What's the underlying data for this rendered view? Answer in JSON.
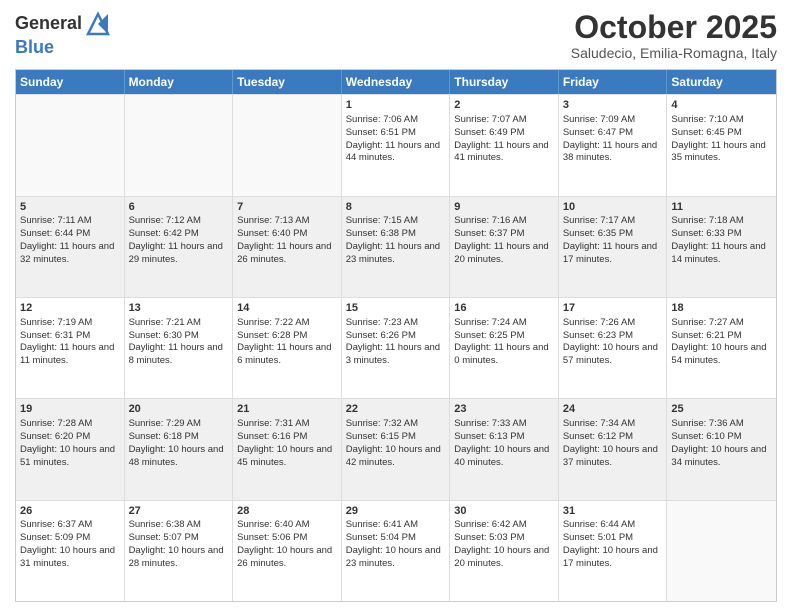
{
  "header": {
    "logo": {
      "line1": "General",
      "line2": "Blue"
    },
    "title": "October 2025",
    "location": "Saludecio, Emilia-Romagna, Italy"
  },
  "days_of_week": [
    "Sunday",
    "Monday",
    "Tuesday",
    "Wednesday",
    "Thursday",
    "Friday",
    "Saturday"
  ],
  "weeks": [
    [
      {
        "day": "",
        "empty": true
      },
      {
        "day": "",
        "empty": true
      },
      {
        "day": "",
        "empty": true
      },
      {
        "day": "1",
        "sunrise": "Sunrise: 7:06 AM",
        "sunset": "Sunset: 6:51 PM",
        "daylight": "Daylight: 11 hours and 44 minutes."
      },
      {
        "day": "2",
        "sunrise": "Sunrise: 7:07 AM",
        "sunset": "Sunset: 6:49 PM",
        "daylight": "Daylight: 11 hours and 41 minutes."
      },
      {
        "day": "3",
        "sunrise": "Sunrise: 7:09 AM",
        "sunset": "Sunset: 6:47 PM",
        "daylight": "Daylight: 11 hours and 38 minutes."
      },
      {
        "day": "4",
        "sunrise": "Sunrise: 7:10 AM",
        "sunset": "Sunset: 6:45 PM",
        "daylight": "Daylight: 11 hours and 35 minutes."
      }
    ],
    [
      {
        "day": "5",
        "sunrise": "Sunrise: 7:11 AM",
        "sunset": "Sunset: 6:44 PM",
        "daylight": "Daylight: 11 hours and 32 minutes."
      },
      {
        "day": "6",
        "sunrise": "Sunrise: 7:12 AM",
        "sunset": "Sunset: 6:42 PM",
        "daylight": "Daylight: 11 hours and 29 minutes."
      },
      {
        "day": "7",
        "sunrise": "Sunrise: 7:13 AM",
        "sunset": "Sunset: 6:40 PM",
        "daylight": "Daylight: 11 hours and 26 minutes."
      },
      {
        "day": "8",
        "sunrise": "Sunrise: 7:15 AM",
        "sunset": "Sunset: 6:38 PM",
        "daylight": "Daylight: 11 hours and 23 minutes."
      },
      {
        "day": "9",
        "sunrise": "Sunrise: 7:16 AM",
        "sunset": "Sunset: 6:37 PM",
        "daylight": "Daylight: 11 hours and 20 minutes."
      },
      {
        "day": "10",
        "sunrise": "Sunrise: 7:17 AM",
        "sunset": "Sunset: 6:35 PM",
        "daylight": "Daylight: 11 hours and 17 minutes."
      },
      {
        "day": "11",
        "sunrise": "Sunrise: 7:18 AM",
        "sunset": "Sunset: 6:33 PM",
        "daylight": "Daylight: 11 hours and 14 minutes."
      }
    ],
    [
      {
        "day": "12",
        "sunrise": "Sunrise: 7:19 AM",
        "sunset": "Sunset: 6:31 PM",
        "daylight": "Daylight: 11 hours and 11 minutes."
      },
      {
        "day": "13",
        "sunrise": "Sunrise: 7:21 AM",
        "sunset": "Sunset: 6:30 PM",
        "daylight": "Daylight: 11 hours and 8 minutes."
      },
      {
        "day": "14",
        "sunrise": "Sunrise: 7:22 AM",
        "sunset": "Sunset: 6:28 PM",
        "daylight": "Daylight: 11 hours and 6 minutes."
      },
      {
        "day": "15",
        "sunrise": "Sunrise: 7:23 AM",
        "sunset": "Sunset: 6:26 PM",
        "daylight": "Daylight: 11 hours and 3 minutes."
      },
      {
        "day": "16",
        "sunrise": "Sunrise: 7:24 AM",
        "sunset": "Sunset: 6:25 PM",
        "daylight": "Daylight: 11 hours and 0 minutes."
      },
      {
        "day": "17",
        "sunrise": "Sunrise: 7:26 AM",
        "sunset": "Sunset: 6:23 PM",
        "daylight": "Daylight: 10 hours and 57 minutes."
      },
      {
        "day": "18",
        "sunrise": "Sunrise: 7:27 AM",
        "sunset": "Sunset: 6:21 PM",
        "daylight": "Daylight: 10 hours and 54 minutes."
      }
    ],
    [
      {
        "day": "19",
        "sunrise": "Sunrise: 7:28 AM",
        "sunset": "Sunset: 6:20 PM",
        "daylight": "Daylight: 10 hours and 51 minutes."
      },
      {
        "day": "20",
        "sunrise": "Sunrise: 7:29 AM",
        "sunset": "Sunset: 6:18 PM",
        "daylight": "Daylight: 10 hours and 48 minutes."
      },
      {
        "day": "21",
        "sunrise": "Sunrise: 7:31 AM",
        "sunset": "Sunset: 6:16 PM",
        "daylight": "Daylight: 10 hours and 45 minutes."
      },
      {
        "day": "22",
        "sunrise": "Sunrise: 7:32 AM",
        "sunset": "Sunset: 6:15 PM",
        "daylight": "Daylight: 10 hours and 42 minutes."
      },
      {
        "day": "23",
        "sunrise": "Sunrise: 7:33 AM",
        "sunset": "Sunset: 6:13 PM",
        "daylight": "Daylight: 10 hours and 40 minutes."
      },
      {
        "day": "24",
        "sunrise": "Sunrise: 7:34 AM",
        "sunset": "Sunset: 6:12 PM",
        "daylight": "Daylight: 10 hours and 37 minutes."
      },
      {
        "day": "25",
        "sunrise": "Sunrise: 7:36 AM",
        "sunset": "Sunset: 6:10 PM",
        "daylight": "Daylight: 10 hours and 34 minutes."
      }
    ],
    [
      {
        "day": "26",
        "sunrise": "Sunrise: 6:37 AM",
        "sunset": "Sunset: 5:09 PM",
        "daylight": "Daylight: 10 hours and 31 minutes."
      },
      {
        "day": "27",
        "sunrise": "Sunrise: 6:38 AM",
        "sunset": "Sunset: 5:07 PM",
        "daylight": "Daylight: 10 hours and 28 minutes."
      },
      {
        "day": "28",
        "sunrise": "Sunrise: 6:40 AM",
        "sunset": "Sunset: 5:06 PM",
        "daylight": "Daylight: 10 hours and 26 minutes."
      },
      {
        "day": "29",
        "sunrise": "Sunrise: 6:41 AM",
        "sunset": "Sunset: 5:04 PM",
        "daylight": "Daylight: 10 hours and 23 minutes."
      },
      {
        "day": "30",
        "sunrise": "Sunrise: 6:42 AM",
        "sunset": "Sunset: 5:03 PM",
        "daylight": "Daylight: 10 hours and 20 minutes."
      },
      {
        "day": "31",
        "sunrise": "Sunrise: 6:44 AM",
        "sunset": "Sunset: 5:01 PM",
        "daylight": "Daylight: 10 hours and 17 minutes."
      },
      {
        "day": "",
        "empty": true
      }
    ]
  ]
}
